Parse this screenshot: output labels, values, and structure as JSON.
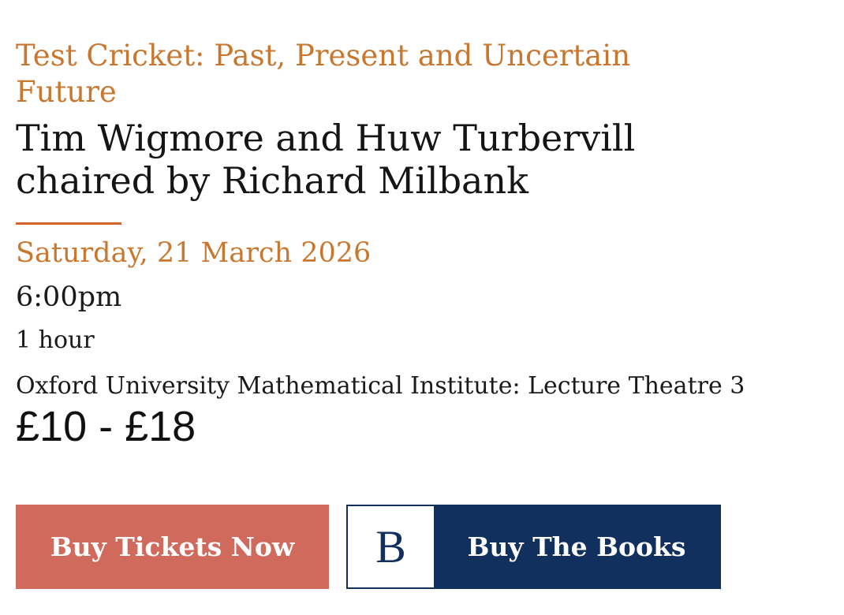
{
  "event": {
    "series_title": "Test Cricket: Past, Present and Uncertain Future",
    "title_line1": "Tim Wigmore and Huw Turbervill",
    "title_line2": "chaired by Richard Milbank",
    "date": "Saturday, 21 March 2026",
    "time": "6:00pm",
    "duration": "1 hour",
    "venue": "Oxford University Mathematical Institute: Lecture Theatre 3",
    "price": "£10 - £18"
  },
  "buttons": {
    "tickets_label": "Buy Tickets Now",
    "books_logo_letter": "B",
    "books_label": "Buy The Books"
  },
  "colors": {
    "accent_orange": "#c9772f",
    "divider": "#d4622c",
    "tickets_button": "#cf6a5c",
    "books_button": "#12305e"
  },
  "icons": {
    "books_logo": "bookshop-b-logo-icon"
  }
}
